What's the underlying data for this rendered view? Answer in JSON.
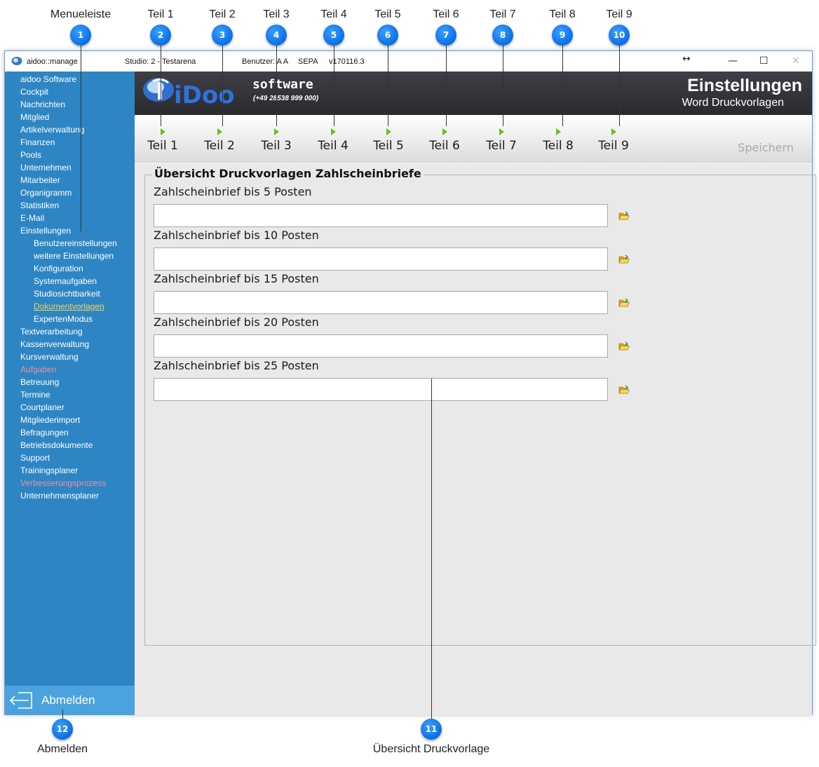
{
  "annotations": {
    "labels": [
      "Menueleiste",
      "Teil 1",
      "Teil 2",
      "Teil 3",
      "Teil 4",
      "Teil 5",
      "Teil 6",
      "Teil 7",
      "Teil 8",
      "Teil 9"
    ],
    "badges": [
      "1",
      "2",
      "3",
      "4",
      "5",
      "6",
      "7",
      "8",
      "9",
      "10"
    ],
    "bottom_labels": [
      "Abmelden",
      "Übersicht Druckvorlage"
    ],
    "bottom_badges": [
      "12",
      "11"
    ],
    "badge_color": "#0a6ee6"
  },
  "window": {
    "app_name": "aidoo::manage",
    "studio": "Studio: 2 - Testarena",
    "benutzer": "Benutzer: A A",
    "sepa": "SEPA",
    "version": "v170116.3",
    "resize_glyph": "↔",
    "minimize": "—",
    "maximize": "☐",
    "close": "✕"
  },
  "sidebar": {
    "background": "#2d86c3",
    "items": [
      {
        "label": "aidoo Software",
        "level": "top",
        "style": ""
      },
      {
        "label": "Cockpit",
        "level": "top",
        "style": ""
      },
      {
        "label": "Nachrichten",
        "level": "top",
        "style": ""
      },
      {
        "label": "Mitglied",
        "level": "top",
        "style": ""
      },
      {
        "label": "Artikelverwaltung",
        "level": "top",
        "style": ""
      },
      {
        "label": "Finanzen",
        "level": "top",
        "style": ""
      },
      {
        "label": "Pools",
        "level": "top",
        "style": ""
      },
      {
        "label": "Unternehmen",
        "level": "top",
        "style": ""
      },
      {
        "label": "Mitarbeiter",
        "level": "top",
        "style": ""
      },
      {
        "label": "Organigramm",
        "level": "top",
        "style": ""
      },
      {
        "label": "Statistiken",
        "level": "top",
        "style": ""
      },
      {
        "label": "E-Mail",
        "level": "top",
        "style": ""
      },
      {
        "label": "Einstellungen",
        "level": "top",
        "style": ""
      },
      {
        "label": "Benutzereinstellungen",
        "level": "sub",
        "style": ""
      },
      {
        "label": "weitere Einstellungen",
        "level": "sub",
        "style": ""
      },
      {
        "label": "Konfiguration",
        "level": "sub",
        "style": ""
      },
      {
        "label": "Systemaufgaben",
        "level": "sub",
        "style": ""
      },
      {
        "label": "Studiosichtbarkeit",
        "level": "sub",
        "style": ""
      },
      {
        "label": "Dokumentvorlagen",
        "level": "sub",
        "style": "active"
      },
      {
        "label": "ExpertenModus",
        "level": "sub",
        "style": ""
      },
      {
        "label": "Textverarbeitung",
        "level": "top",
        "style": ""
      },
      {
        "label": "Kassenverwaltung",
        "level": "top",
        "style": ""
      },
      {
        "label": "Kursverwaltung",
        "level": "top",
        "style": ""
      },
      {
        "label": "Aufgaben",
        "level": "top",
        "style": "red"
      },
      {
        "label": "Betreuung",
        "level": "top",
        "style": ""
      },
      {
        "label": "Termine",
        "level": "top",
        "style": ""
      },
      {
        "label": "Courtplaner",
        "level": "top",
        "style": ""
      },
      {
        "label": "Mitgliederimport",
        "level": "top",
        "style": ""
      },
      {
        "label": "Befragungen",
        "level": "top",
        "style": ""
      },
      {
        "label": "Betriebsdokumente",
        "level": "top",
        "style": ""
      },
      {
        "label": "Support",
        "level": "top",
        "style": ""
      },
      {
        "label": "Trainingsplaner",
        "level": "top",
        "style": ""
      },
      {
        "label": "Verbesserungsprozess",
        "level": "top",
        "style": "red"
      },
      {
        "label": "Unternehmensplaner",
        "level": "top",
        "style": ""
      }
    ],
    "logout_label": "Abmelden"
  },
  "header": {
    "logo_text": "iDoo",
    "logo_software": "software",
    "logo_phone": "(+49 28538 999 000)",
    "title": "Einstellungen",
    "subtitle": "Word Druckvorlagen"
  },
  "toolbar": {
    "tabs": [
      "Teil 1",
      "Teil 2",
      "Teil 3",
      "Teil 4",
      "Teil 5",
      "Teil 6",
      "Teil 7",
      "Teil 8",
      "Teil 9"
    ],
    "save_label": "Speichern",
    "arrow_color": "#6bbf1a"
  },
  "content": {
    "group_title": "Übersicht Druckvorlagen Zahlscheinbriefe",
    "fields": [
      {
        "label": "Zahlscheinbrief bis 5 Posten",
        "value": ""
      },
      {
        "label": "Zahlscheinbrief bis 10 Posten",
        "value": ""
      },
      {
        "label": "Zahlscheinbrief bis 15 Posten",
        "value": ""
      },
      {
        "label": "Zahlscheinbrief bis 20 Posten",
        "value": ""
      },
      {
        "label": "Zahlscheinbrief bis 25 Posten",
        "value": ""
      }
    ],
    "browse_icon": "folder-open-icon"
  }
}
